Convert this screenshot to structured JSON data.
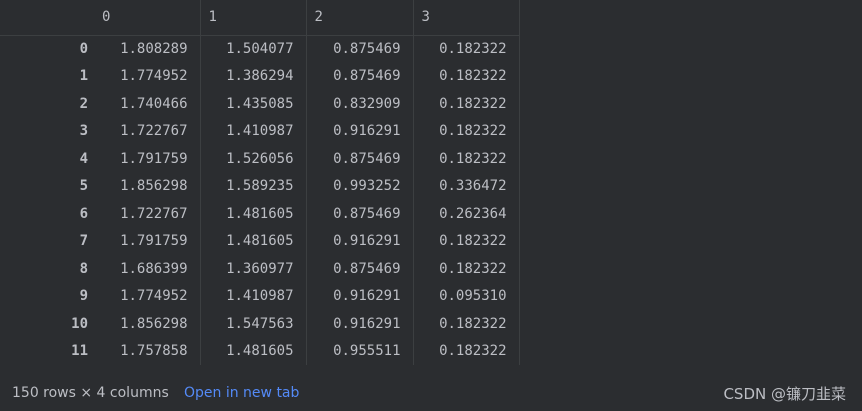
{
  "table": {
    "columns": [
      "0",
      "1",
      "2",
      "3"
    ],
    "rows": [
      {
        "index": "0",
        "values": [
          "1.808289",
          "1.504077",
          "0.875469",
          "0.182322"
        ]
      },
      {
        "index": "1",
        "values": [
          "1.774952",
          "1.386294",
          "0.875469",
          "0.182322"
        ]
      },
      {
        "index": "2",
        "values": [
          "1.740466",
          "1.435085",
          "0.832909",
          "0.182322"
        ]
      },
      {
        "index": "3",
        "values": [
          "1.722767",
          "1.410987",
          "0.916291",
          "0.182322"
        ]
      },
      {
        "index": "4",
        "values": [
          "1.791759",
          "1.526056",
          "0.875469",
          "0.182322"
        ]
      },
      {
        "index": "5",
        "values": [
          "1.856298",
          "1.589235",
          "0.993252",
          "0.336472"
        ]
      },
      {
        "index": "6",
        "values": [
          "1.722767",
          "1.481605",
          "0.875469",
          "0.262364"
        ]
      },
      {
        "index": "7",
        "values": [
          "1.791759",
          "1.481605",
          "0.916291",
          "0.182322"
        ]
      },
      {
        "index": "8",
        "values": [
          "1.686399",
          "1.360977",
          "0.875469",
          "0.182322"
        ]
      },
      {
        "index": "9",
        "values": [
          "1.774952",
          "1.410987",
          "0.916291",
          "0.095310"
        ]
      },
      {
        "index": "10",
        "values": [
          "1.856298",
          "1.547563",
          "0.916291",
          "0.182322"
        ]
      },
      {
        "index": "11",
        "values": [
          "1.757858",
          "1.481605",
          "0.955511",
          "0.182322"
        ]
      }
    ]
  },
  "footer": {
    "rows_info": "150 rows × 4 columns",
    "open_link": "Open in new tab",
    "watermark": "CSDN @镰刀韭菜"
  },
  "colors": {
    "background": "#2b2d30",
    "text": "#bcbec4",
    "link": "#548af7",
    "grid": "#3c3f41"
  }
}
